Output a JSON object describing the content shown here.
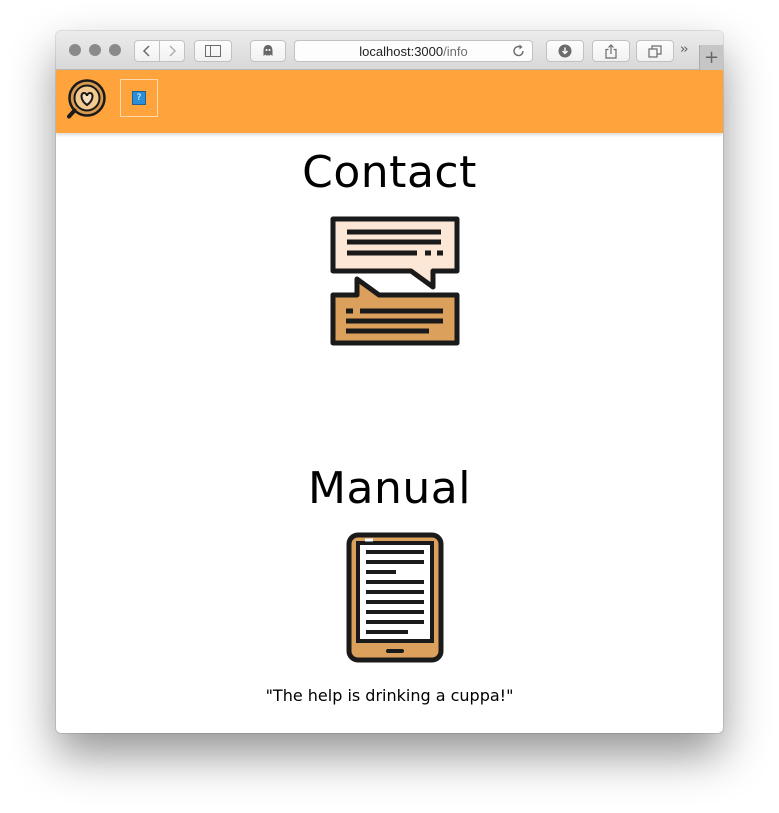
{
  "browser": {
    "address_host": "localhost:3000",
    "address_path": "/info",
    "icons": [
      "back-arrow-icon",
      "forward-arrow-icon",
      "sidebar-icon",
      "ghost-icon",
      "reload-icon",
      "download-icon",
      "share-icon",
      "tabs-icon",
      "new-tab-icon"
    ]
  },
  "header": {
    "background_color": "#ffa33d",
    "help_button_icon": "?"
  },
  "sections": {
    "contact_heading": "Contact",
    "manual_heading": "Manual"
  },
  "tagline": "\"The help is drinking a cuppa!\""
}
